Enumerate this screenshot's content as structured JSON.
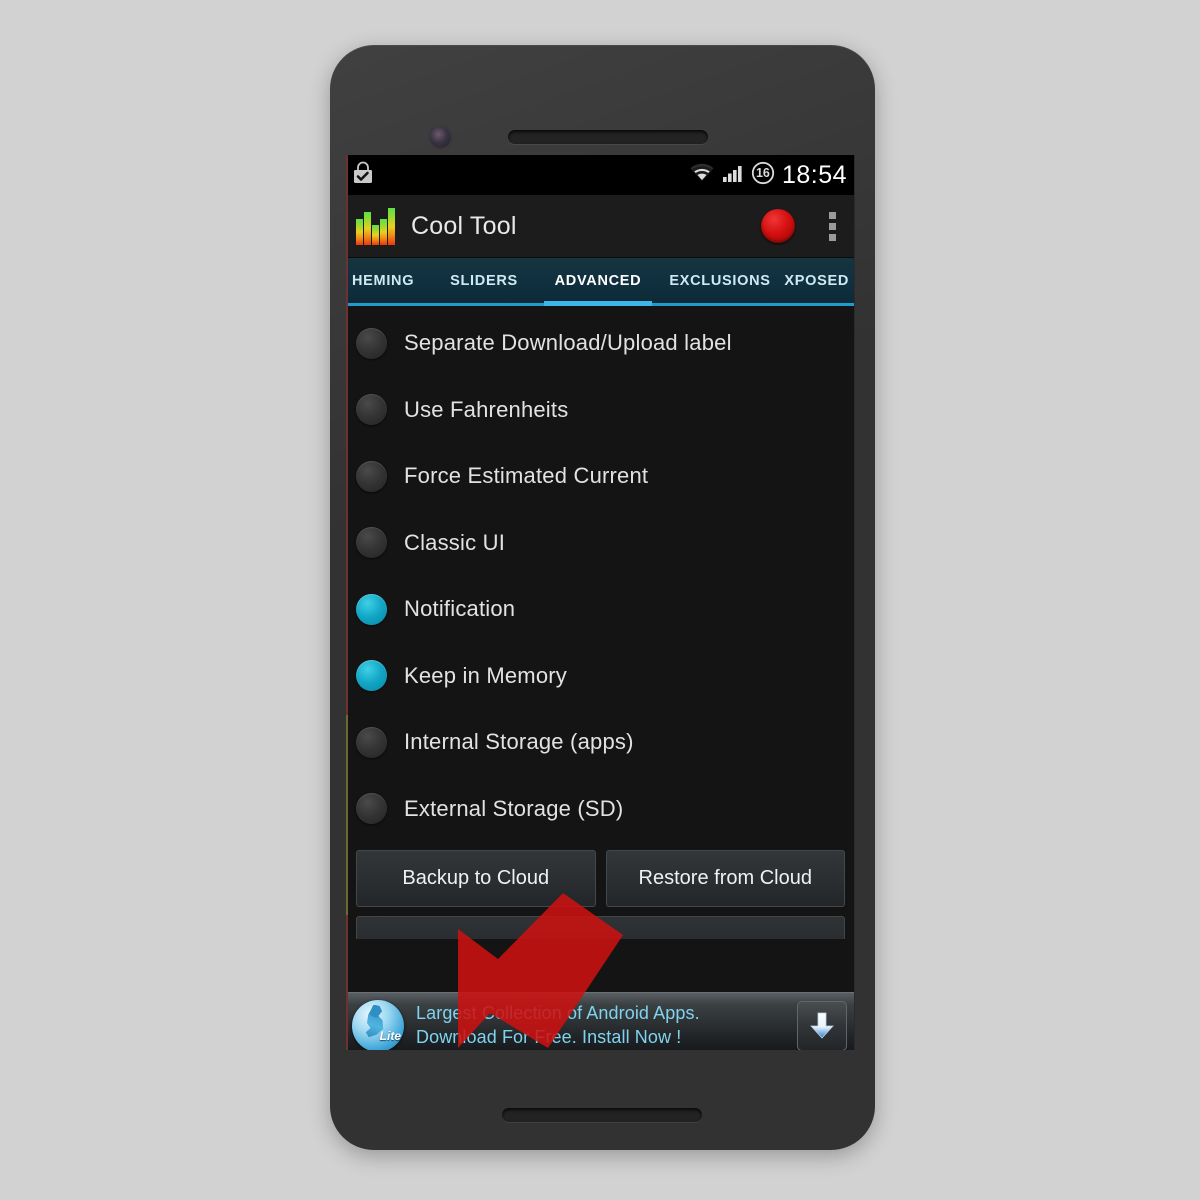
{
  "device": {
    "camera_icon": "front-camera",
    "earpiece_icon": "earpiece-speaker",
    "bottom_speaker_icon": "bottom-speaker"
  },
  "status_bar": {
    "left_icons": [
      {
        "name": "play-store-download-complete-icon",
        "glyph": "shopping-bag-check"
      }
    ],
    "right_icons": [
      {
        "name": "wifi-icon",
        "glyph": "wifi"
      },
      {
        "name": "cellular-signal-icon",
        "glyph": "signal-bars"
      },
      {
        "name": "battery-percent-icon",
        "glyph": "circled-number",
        "value": "16"
      }
    ],
    "time": "18:54"
  },
  "action_bar": {
    "app_icon": "equalizer-bars-icon",
    "title": "Cool Tool",
    "record_button": "record-button",
    "overflow_button": "overflow-menu-icon"
  },
  "tabs": {
    "active_index": 2,
    "items": [
      {
        "label": "HEMING",
        "full": "THEMING",
        "clipped": "left"
      },
      {
        "label": "SLIDERS",
        "clipped": "none"
      },
      {
        "label": "ADVANCED",
        "clipped": "none"
      },
      {
        "label": "EXCLUSIONS",
        "clipped": "none"
      },
      {
        "label": "XPOSED",
        "clipped": "right"
      }
    ],
    "accent_color": "#3fb6e8"
  },
  "settings": {
    "rows": [
      {
        "label": "Separate Download/Upload label",
        "checked": false
      },
      {
        "label": "Use Fahrenheits",
        "checked": false
      },
      {
        "label": "Force Estimated Current",
        "checked": false
      },
      {
        "label": "Classic UI",
        "checked": false
      },
      {
        "label": "Notification",
        "checked": true
      },
      {
        "label": "Keep in Memory",
        "checked": true
      },
      {
        "label": "Internal Storage (apps)",
        "checked": false
      },
      {
        "label": "External Storage (SD)",
        "checked": false
      }
    ],
    "checked_color": "#11a5c4",
    "unchecked_color": "#333333"
  },
  "cloud_actions": {
    "backup_label": "Backup to Cloud",
    "restore_label": "Restore from Cloud"
  },
  "ad_banner": {
    "logo_name": "app-store-lite-logo",
    "logo_badge": "Lite",
    "line1": "Largest Collection of Android Apps.",
    "line2": "Download For Free. Install Now !",
    "download_button": "download-arrow-button",
    "text_color": "#7fd3ee"
  },
  "overlay": {
    "arrow_name": "annotation-arrow-down-left",
    "arrow_color": "#cc1111"
  }
}
